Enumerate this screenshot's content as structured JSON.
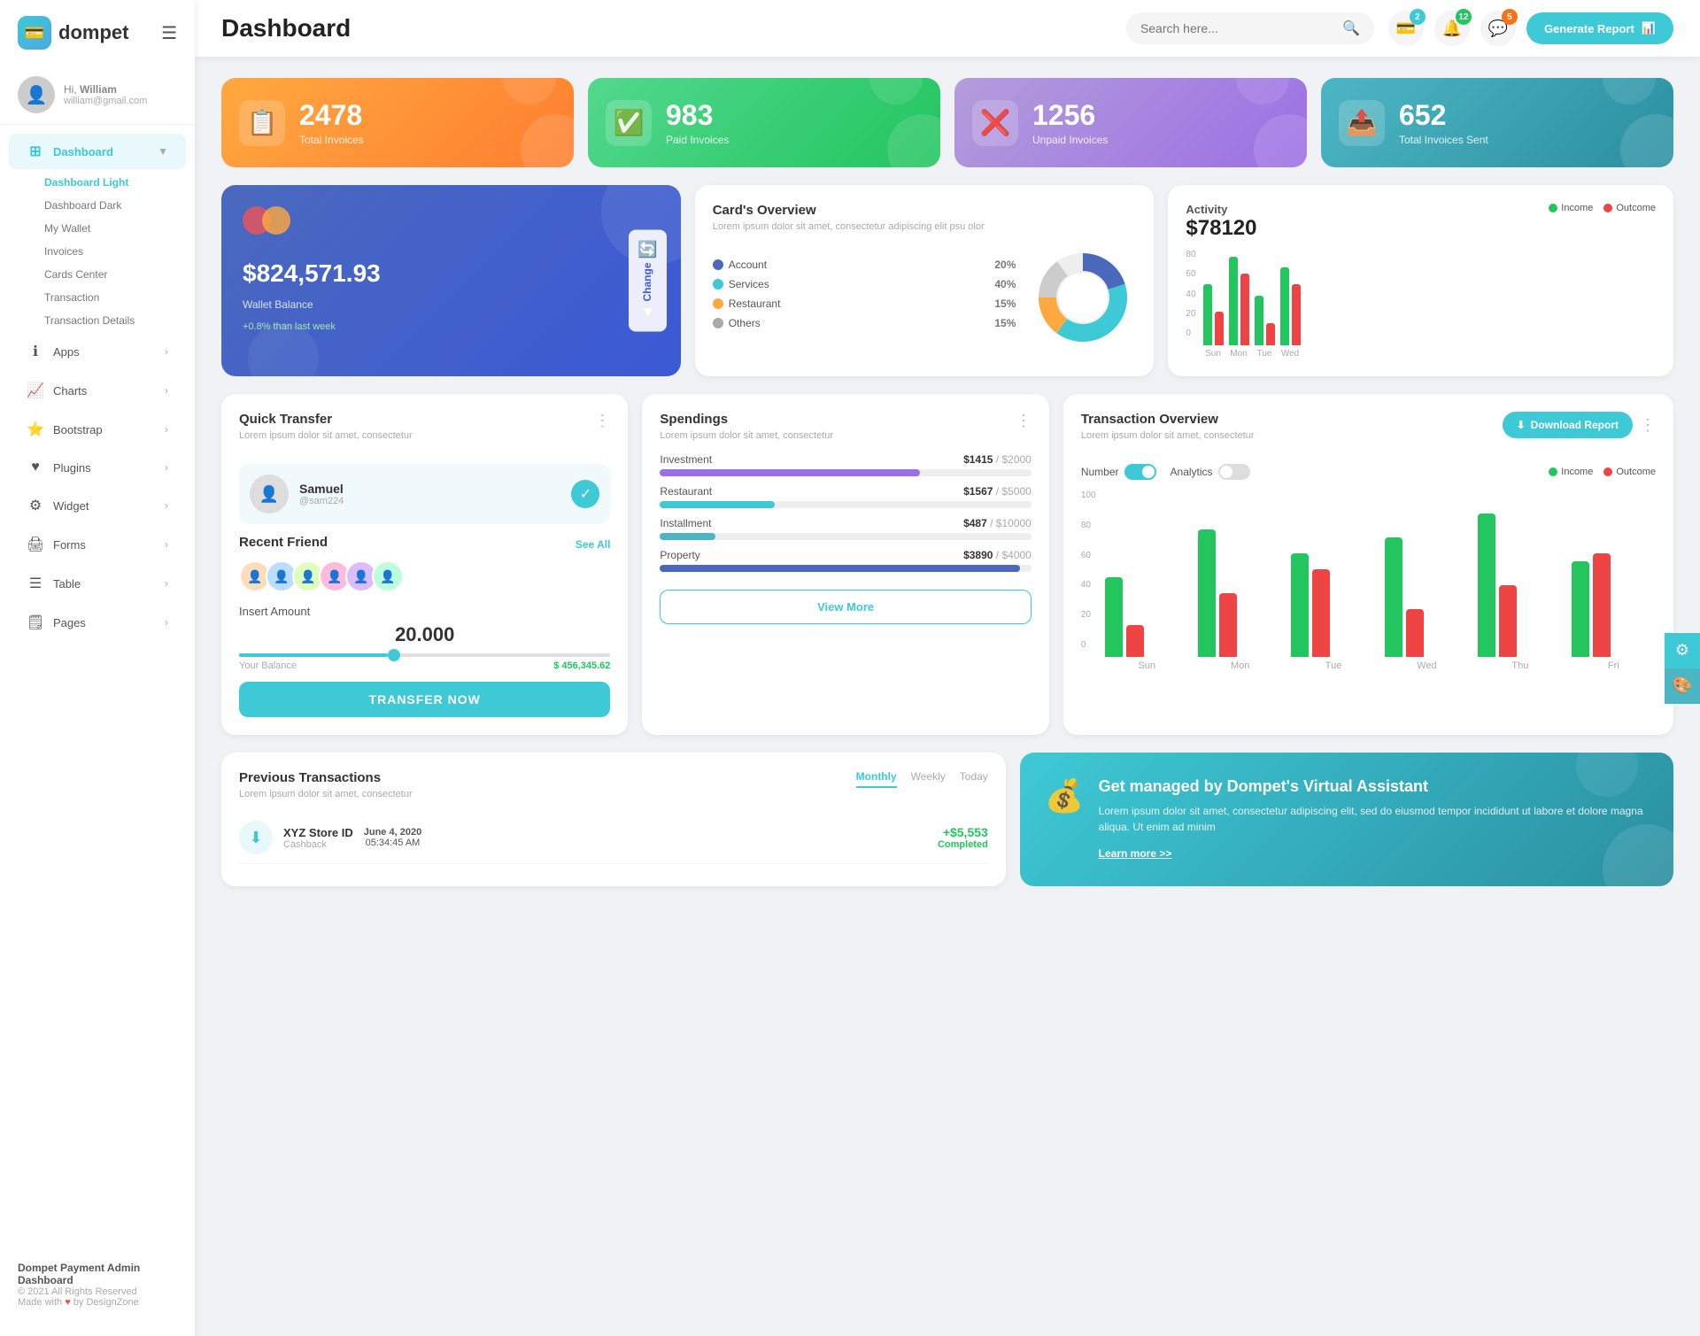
{
  "app": {
    "name": "dompet",
    "logo_char": "💳"
  },
  "header": {
    "title": "Dashboard",
    "search_placeholder": "Search here...",
    "generate_report": "Generate Report",
    "notifications_count": "2",
    "alerts_count": "12",
    "messages_count": "5"
  },
  "user": {
    "greeting": "Hi,",
    "name": "William",
    "email": "william@gmail.com",
    "avatar_char": "👤"
  },
  "sidebar": {
    "nav_items": [
      {
        "id": "dashboard",
        "label": "Dashboard",
        "icon": "⊞",
        "active": true,
        "has_arrow": true
      },
      {
        "id": "apps",
        "label": "Apps",
        "icon": "ℹ",
        "has_arrow": true
      },
      {
        "id": "charts",
        "label": "Charts",
        "icon": "📈",
        "has_arrow": true
      },
      {
        "id": "bootstrap",
        "label": "Bootstrap",
        "icon": "⭐",
        "has_arrow": true
      },
      {
        "id": "plugins",
        "label": "Plugins",
        "icon": "♥",
        "has_arrow": true
      },
      {
        "id": "widget",
        "label": "Widget",
        "icon": "⚙",
        "has_arrow": true
      },
      {
        "id": "forms",
        "label": "Forms",
        "icon": "🖨",
        "has_arrow": true
      },
      {
        "id": "table",
        "label": "Table",
        "icon": "☰",
        "has_arrow": true
      },
      {
        "id": "pages",
        "label": "Pages",
        "icon": "🗒",
        "has_arrow": true
      }
    ],
    "sub_items": [
      {
        "label": "Dashboard Light",
        "active": true
      },
      {
        "label": "Dashboard Dark",
        "active": false
      },
      {
        "label": "My Wallet",
        "active": false
      },
      {
        "label": "Invoices",
        "active": false
      },
      {
        "label": "Cards Center",
        "active": false
      },
      {
        "label": "Transaction",
        "active": false
      },
      {
        "label": "Transaction Details",
        "active": false
      }
    ],
    "footer_brand": "Dompet Payment Admin Dashboard",
    "footer_copy": "© 2021 All Rights Reserved",
    "footer_made": "Made with",
    "footer_by": "by DesignZone"
  },
  "stat_cards": [
    {
      "num": "2478",
      "label": "Total Invoices",
      "icon": "📋",
      "color": "orange"
    },
    {
      "num": "983",
      "label": "Paid Invoices",
      "icon": "✅",
      "color": "green"
    },
    {
      "num": "1256",
      "label": "Unpaid Invoices",
      "icon": "❌",
      "color": "purple"
    },
    {
      "num": "652",
      "label": "Total Invoices Sent",
      "icon": "📤",
      "color": "teal"
    }
  ],
  "wallet": {
    "balance": "$824,571.93",
    "label": "Wallet Balance",
    "sublabel": "+0.8% than last week",
    "change_btn": "Change"
  },
  "cards_overview": {
    "title": "Card's Overview",
    "subtitle": "Lorem ipsum dolor sit amet, consectetur adipiscing elit psu olor",
    "items": [
      {
        "label": "Account",
        "color": "#4a69bd",
        "pct": "20%"
      },
      {
        "label": "Services",
        "color": "#3ec9d6",
        "pct": "40%"
      },
      {
        "label": "Restaurant",
        "color": "#ffa940",
        "pct": "15%"
      },
      {
        "label": "Others",
        "color": "#aaa",
        "pct": "15%"
      }
    ]
  },
  "activity": {
    "title": "Activity",
    "amount": "$78120",
    "income_label": "Income",
    "outcome_label": "Outcome",
    "bars": [
      {
        "day": "Sun",
        "income": 55,
        "outcome": 30
      },
      {
        "day": "Mon",
        "income": 80,
        "outcome": 65
      },
      {
        "day": "Tue",
        "income": 45,
        "outcome": 20
      },
      {
        "day": "Wed",
        "income": 70,
        "outcome": 55
      }
    ]
  },
  "quick_transfer": {
    "title": "Quick Transfer",
    "subtitle": "Lorem ipsum dolor sit amet, consectetur",
    "user_name": "Samuel",
    "user_handle": "@sam224",
    "recent_friends": "Recent Friend",
    "see_all": "See All",
    "insert_amount": "Insert Amount",
    "amount": "20.000",
    "balance_label": "Your Balance",
    "balance_val": "$ 456,345.62",
    "transfer_btn": "TRANSFER NOW"
  },
  "spendings": {
    "title": "Spendings",
    "subtitle": "Lorem ipsum dolor sit amet, consectetur",
    "items": [
      {
        "label": "Investment",
        "amount": "$1415",
        "max": "$2000",
        "pct": 70,
        "color": "#9c6fe4"
      },
      {
        "label": "Restaurant",
        "amount": "$1567",
        "max": "$5000",
        "pct": 31,
        "color": "#3ec9d6"
      },
      {
        "label": "Installment",
        "amount": "$487",
        "max": "$10000",
        "pct": 15,
        "color": "#4db6c4"
      },
      {
        "label": "Property",
        "amount": "$3890",
        "max": "$4000",
        "pct": 97,
        "color": "#4a69bd"
      }
    ],
    "view_more": "View More"
  },
  "tx_overview": {
    "title": "Transaction Overview",
    "subtitle": "Lorem ipsum dolor sit amet, consectetur",
    "download_btn": "Download Report",
    "number_label": "Number",
    "analytics_label": "Analytics",
    "income_label": "Income",
    "outcome_label": "Outcome",
    "bars": [
      {
        "day": "Sun",
        "income": 50,
        "outcome": 20
      },
      {
        "day": "Mon",
        "income": 80,
        "outcome": 40
      },
      {
        "day": "Tue",
        "income": 65,
        "outcome": 55
      },
      {
        "day": "Wed",
        "income": 75,
        "outcome": 30
      },
      {
        "day": "Thu",
        "income": 90,
        "outcome": 45
      },
      {
        "day": "Fri",
        "income": 60,
        "outcome": 65
      }
    ]
  },
  "prev_transactions": {
    "title": "Previous Transactions",
    "subtitle": "Lorem ipsum dolor sit amet, consectetur",
    "tabs": [
      "Monthly",
      "Weekly",
      "Today"
    ],
    "active_tab": "Monthly",
    "transactions": [
      {
        "name": "XYZ Store ID",
        "type": "Cashback",
        "date": "June 4, 2020",
        "time": "05:34:45 AM",
        "amount": "+$5,553",
        "status": "Completed",
        "icon": "⬇"
      }
    ]
  },
  "virtual_assistant": {
    "title": "Get managed by Dompet's Virtual Assistant",
    "text": "Lorem ipsum dolor sit amet, consectetur adipiscing elit, sed do eiusmod tempor incididunt ut labore et dolore magna aliqua. Ut enim ad minim",
    "link": "Learn more >>",
    "icon": "💰"
  }
}
